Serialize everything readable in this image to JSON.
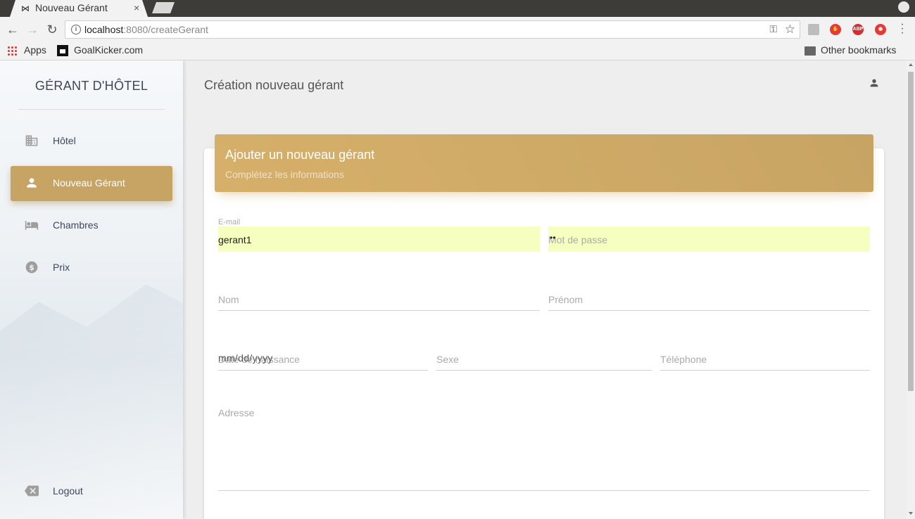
{
  "browser": {
    "tab_title": "Nouveau Gérant",
    "tab_close": "×",
    "url_host": "localhost",
    "url_path": ":8080/createGerant",
    "bookmarks": {
      "apps": "Apps",
      "goalkicker": "GoalKicker.com",
      "other": "Other bookmarks"
    },
    "extensions": [
      "adblock-hand-icon",
      "abp-icon",
      "ublock-icon"
    ]
  },
  "sidebar": {
    "brand": "GÉRANT D'HÔTEL",
    "items": [
      {
        "label": "Hôtel",
        "icon": "building-icon",
        "active": false
      },
      {
        "label": "Nouveau Gérant",
        "icon": "person-icon",
        "active": true
      },
      {
        "label": "Chambres",
        "icon": "bed-icon",
        "active": false
      },
      {
        "label": "Prix",
        "icon": "dollar-icon",
        "active": false
      }
    ],
    "logout": {
      "label": "Logout",
      "icon": "backspace-icon"
    }
  },
  "header": {
    "title": "Création nouveau gérant"
  },
  "form": {
    "title": "Ajouter un nouveau gérant",
    "subtitle": "Complétez les informations",
    "email": {
      "label": "E-mail",
      "value": "gerant1"
    },
    "password": {
      "placeholder": "Mot de passe",
      "value": "••"
    },
    "nom": {
      "placeholder": "Nom"
    },
    "prenom": {
      "placeholder": "Prénom"
    },
    "naissance": {
      "placeholder": "Date de naissance",
      "date_hint": "mm/dd/yyyy"
    },
    "sexe": {
      "placeholder": "Sexe"
    },
    "telephone": {
      "placeholder": "Téléphone"
    },
    "adresse": {
      "placeholder": "Adresse"
    }
  },
  "colors": {
    "accent": "#c8a464",
    "autofill": "#f7ffc0"
  }
}
